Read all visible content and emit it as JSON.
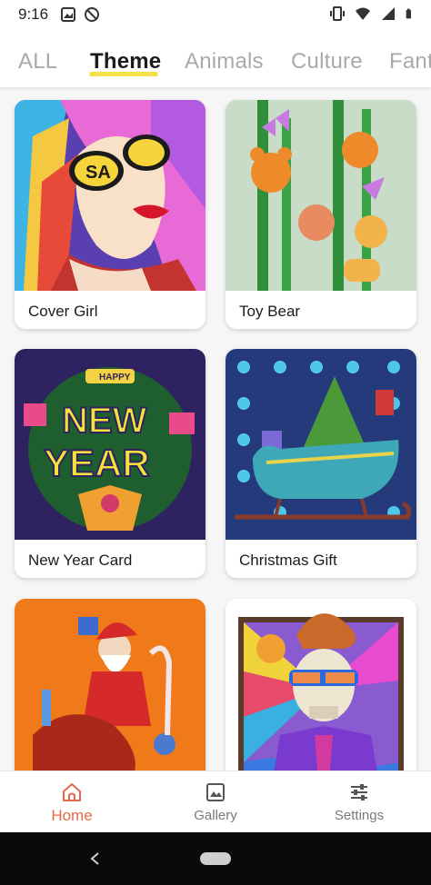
{
  "status_bar": {
    "time": "9:16",
    "left_icons": [
      "photo-icon",
      "dnd-icon"
    ],
    "right_icons": [
      "vibrate-icon",
      "wifi-icon",
      "signal-icon",
      "battery-icon"
    ]
  },
  "tabs": [
    {
      "label": "ALL",
      "active": false
    },
    {
      "label": "Theme",
      "active": true
    },
    {
      "label": "Animals",
      "active": false
    },
    {
      "label": "Culture",
      "active": false
    },
    {
      "label": "Fant",
      "active": false
    }
  ],
  "cards": [
    {
      "title": "Cover Girl",
      "icon": "cover-girl-art"
    },
    {
      "title": "Toy Bear",
      "icon": "toy-bear-art"
    },
    {
      "title": "New Year Card",
      "icon": "new-year-art"
    },
    {
      "title": "Christmas Gift",
      "icon": "christmas-sleigh-art"
    },
    {
      "title": "",
      "icon": "santa-art"
    },
    {
      "title": "",
      "icon": "skull-art"
    }
  ],
  "bottom_nav": [
    {
      "label": "Home",
      "icon": "home-icon",
      "active": true
    },
    {
      "label": "Gallery",
      "icon": "gallery-icon",
      "active": false
    },
    {
      "label": "Settings",
      "icon": "settings-icon",
      "active": false
    }
  ],
  "colors": {
    "accent": "#e8694a",
    "tab_underline": "#f5e04a",
    "inactive_tab": "#a9a9a9"
  }
}
